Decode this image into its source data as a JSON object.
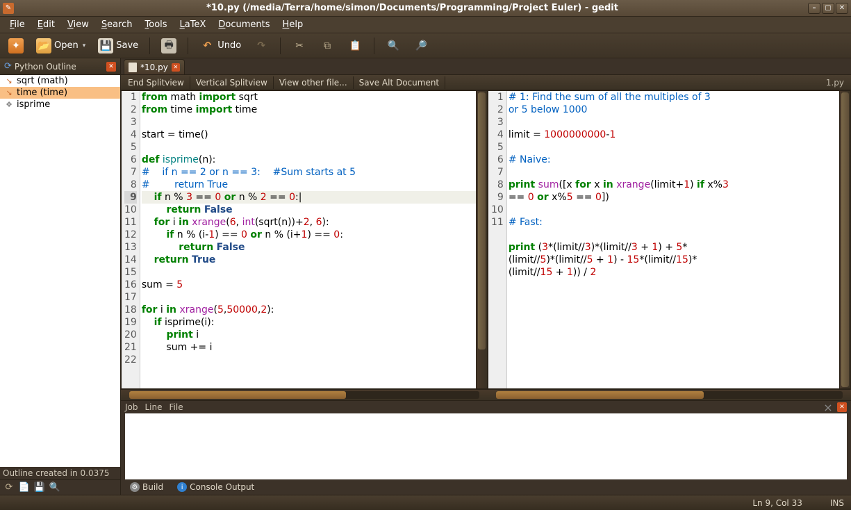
{
  "titlebar": {
    "title": "*10.py (/media/Terra/home/simon/Documents/Programming/Project Euler) - gedit"
  },
  "menu": {
    "file": "File",
    "edit": "Edit",
    "view": "View",
    "search": "Search",
    "tools": "Tools",
    "latex": "LaTeX",
    "documents": "Documents",
    "help": "Help"
  },
  "toolbar": {
    "open": "Open",
    "save": "Save",
    "undo": "Undo"
  },
  "sidebar": {
    "title": "Python Outline",
    "items": [
      {
        "icon": "fn",
        "label": "sqrt (math)"
      },
      {
        "icon": "fn",
        "label": "time (time)"
      },
      {
        "icon": "cls",
        "label": "isprime"
      }
    ],
    "footer": "Outline created in 0.0375"
  },
  "tabs": {
    "tab1": "*10.py"
  },
  "subtoolbar": {
    "end": "End Splitview",
    "vert": "Vertical Splitview",
    "other": "View other file...",
    "savealt": "Save Alt Document",
    "right": "1.py"
  },
  "left_editor": {
    "lines": [
      {
        "n": 1,
        "html": "<span class='kw'>from</span> math <span class='kw'>import</span> sqrt"
      },
      {
        "n": 2,
        "html": "<span class='kw'>from</span> time <span class='kw'>import</span> time"
      },
      {
        "n": 3,
        "html": ""
      },
      {
        "n": 4,
        "html": "start = time()"
      },
      {
        "n": 5,
        "html": ""
      },
      {
        "n": 6,
        "html": "<span class='kw'>def</span> <span class='fnname'>isprime</span>(n):"
      },
      {
        "n": 7,
        "html": "<span class='cm'>#    if n == 2 or n == 3:    #Sum starts at 5</span>"
      },
      {
        "n": 8,
        "html": "<span class='cm'>#        return True</span>"
      },
      {
        "n": 9,
        "current": true,
        "html": "    <span class='kw'>if</span> n % <span class='num'>3</span> == <span class='num'>0</span> <span class='kw'>or</span> n % <span class='num'>2</span> == <span class='num'>0</span>:|"
      },
      {
        "n": 10,
        "html": "        <span class='kw'>return</span> <span class='kw2'>False</span>"
      },
      {
        "n": 11,
        "html": "    <span class='kw'>for</span> i <span class='kw'>in</span> <span class='fn'>xrange</span>(<span class='num'>6</span>, <span class='fn'>int</span>(sqrt(n))+<span class='num'>2</span>, <span class='num'>6</span>):"
      },
      {
        "n": 12,
        "html": "        <span class='kw'>if</span> n % (i-<span class='num'>1</span>) == <span class='num'>0</span> <span class='kw'>or</span> n % (i+<span class='num'>1</span>) == <span class='num'>0</span>:"
      },
      {
        "n": 13,
        "html": "            <span class='kw'>return</span> <span class='kw2'>False</span>"
      },
      {
        "n": 14,
        "html": "    <span class='kw'>return</span> <span class='kw2'>True</span>"
      },
      {
        "n": 15,
        "html": ""
      },
      {
        "n": 16,
        "html": "sum = <span class='num'>5</span>"
      },
      {
        "n": 17,
        "html": ""
      },
      {
        "n": 18,
        "html": "<span class='kw'>for</span> i <span class='kw'>in</span> <span class='fn'>xrange</span>(<span class='num'>5</span>,<span class='num'>50000</span>,<span class='num'>2</span>):"
      },
      {
        "n": 19,
        "html": "    <span class='kw'>if</span> isprime(i):"
      },
      {
        "n": 20,
        "html": "        <span class='kw'>print</span> i"
      },
      {
        "n": 21,
        "html": "        sum += i"
      },
      {
        "n": 22,
        "html": ""
      }
    ]
  },
  "right_editor": {
    "lines": [
      {
        "n": 1,
        "html": "<span class='cm'># 1: Find the sum of all the multiples of 3</span>"
      },
      {
        "n": "",
        "html": "<span class='cm'>or 5 below 1000</span>"
      },
      {
        "n": 2,
        "html": ""
      },
      {
        "n": 3,
        "html": "limit = <span class='num'>1000000000</span>-<span class='num'>1</span>"
      },
      {
        "n": 4,
        "html": ""
      },
      {
        "n": 5,
        "html": "<span class='cm'># Naive:</span>"
      },
      {
        "n": 6,
        "html": ""
      },
      {
        "n": 7,
        "html": "<span class='kw'>print</span> <span class='fn'>sum</span>([x <span class='kw'>for</span> x <span class='kw'>in</span> <span class='fn'>xrange</span>(limit+<span class='num'>1</span>) <span class='kw'>if</span> x%<span class='num'>3</span>"
      },
      {
        "n": "",
        "html": "== <span class='num'>0</span> <span class='kw'>or</span> x%<span class='num'>5</span> == <span class='num'>0</span>])"
      },
      {
        "n": 8,
        "html": ""
      },
      {
        "n": 9,
        "html": "<span class='cm'># Fast:</span>"
      },
      {
        "n": 10,
        "html": ""
      },
      {
        "n": 11,
        "html": "<span class='kw'>print</span> (<span class='num'>3</span>*(limit//<span class='num'>3</span>)*(limit//<span class='num'>3</span> + <span class='num'>1</span>) + <span class='num'>5</span>*"
      },
      {
        "n": "",
        "html": "(limit//<span class='num'>5</span>)*(limit//<span class='num'>5</span> + <span class='num'>1</span>) - <span class='num'>15</span>*(limit//<span class='num'>15</span>)*"
      },
      {
        "n": "",
        "html": "(limit//<span class='num'>15</span> + <span class='num'>1</span>)) / <span class='num'>2</span>"
      }
    ]
  },
  "bottom": {
    "headers": [
      "Job",
      "Line",
      "File"
    ],
    "tabs": {
      "build": "Build",
      "console": "Console Output"
    }
  },
  "status": {
    "pos": "Ln 9, Col 33",
    "mode": "INS"
  }
}
